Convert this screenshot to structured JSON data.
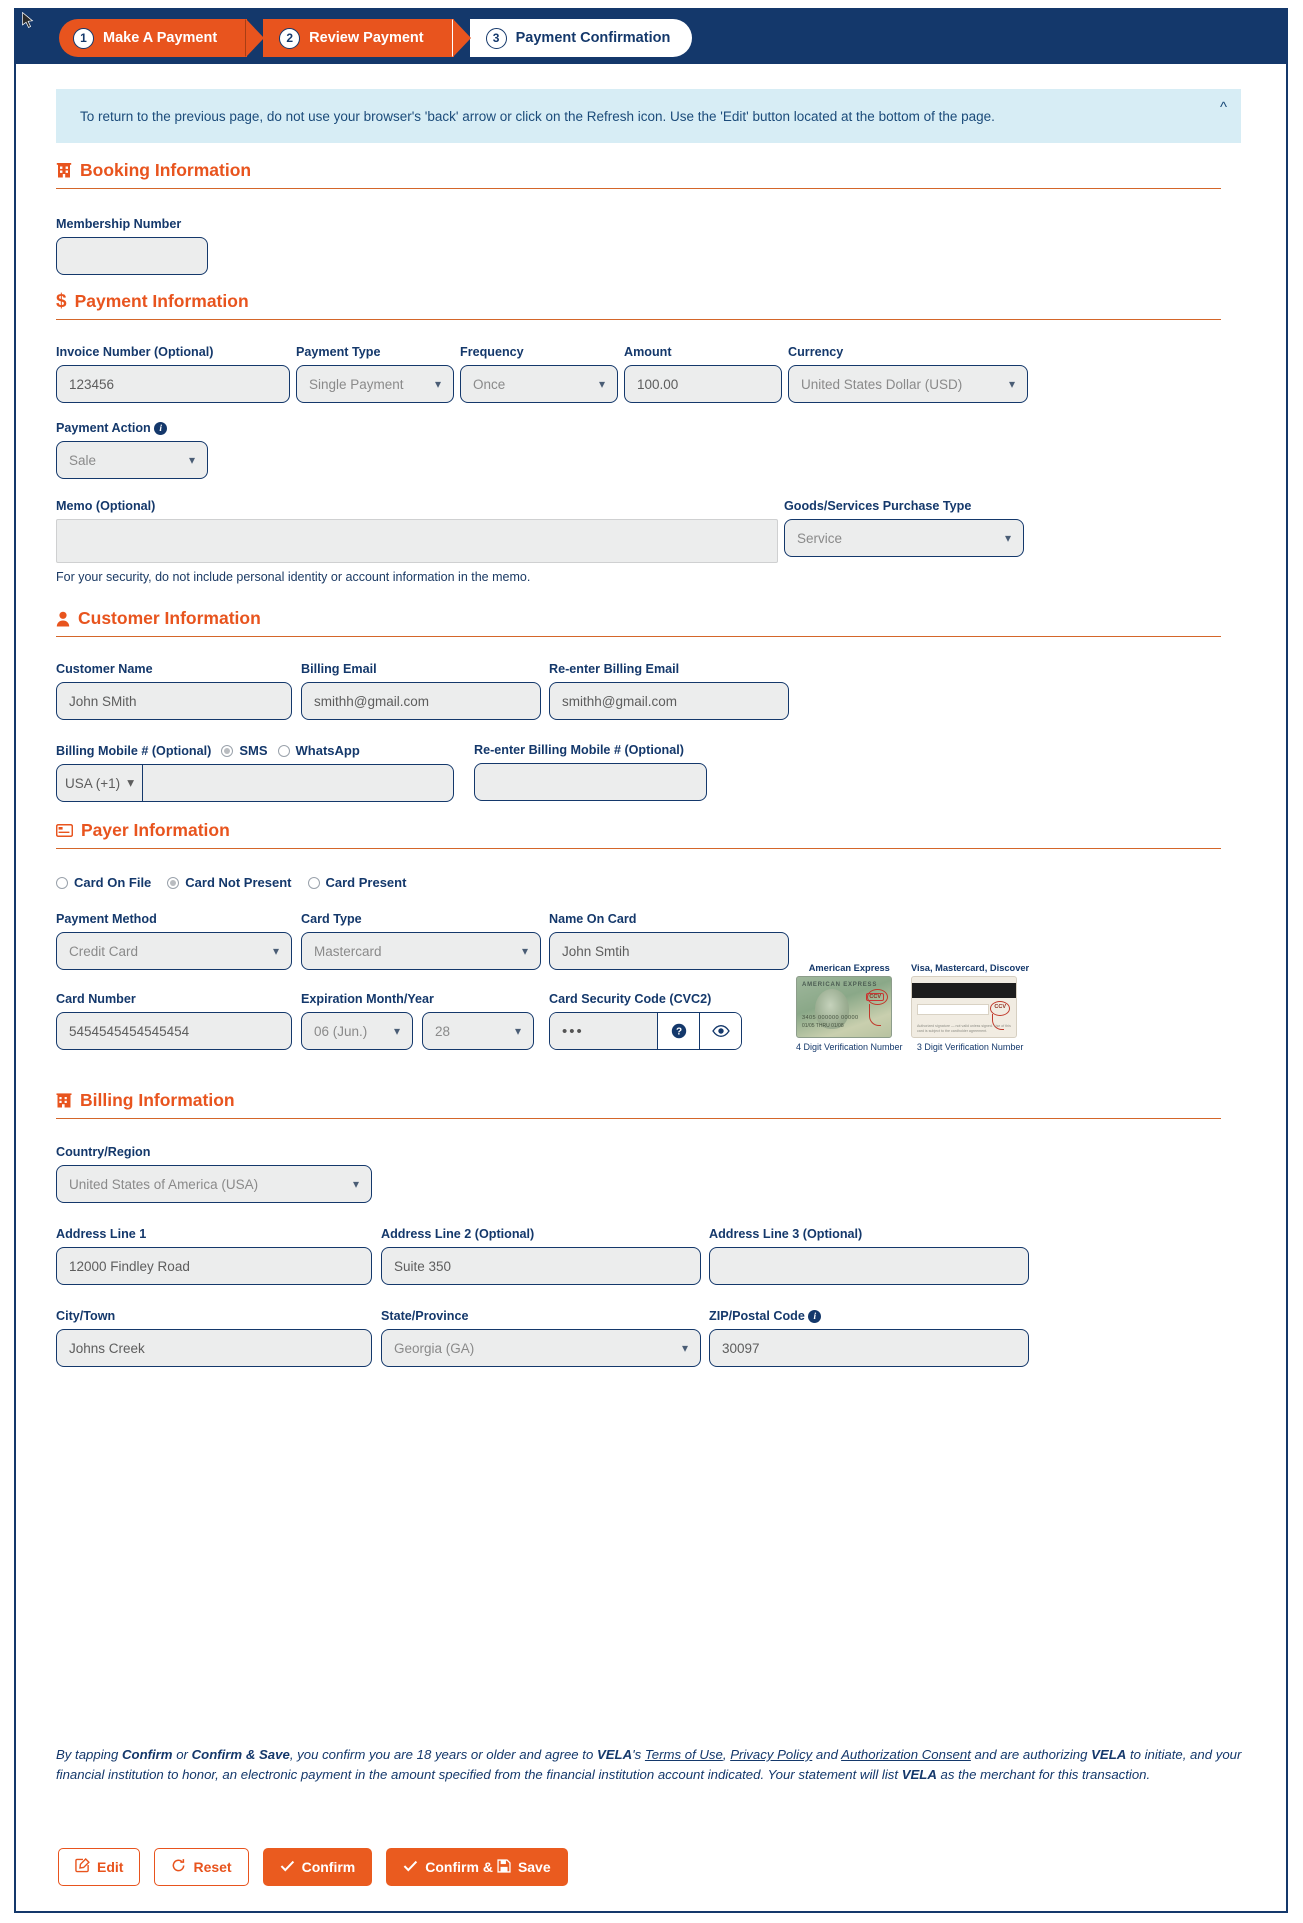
{
  "steps": [
    {
      "num": "1",
      "label": "Make A Payment",
      "state": "done"
    },
    {
      "num": "2",
      "label": "Review Payment",
      "state": "done"
    },
    {
      "num": "3",
      "label": "Payment Confirmation",
      "state": "current"
    }
  ],
  "alert": {
    "text": "To return to the previous page, do not use your browser's 'back' arrow or click on the Refresh icon. Use the 'Edit' button located at the bottom of the page.",
    "collapse_icon": "chevron-up-icon"
  },
  "booking": {
    "heading": "Booking Information",
    "icon": "building-icon",
    "membership_label": "Membership Number",
    "membership_value": ""
  },
  "payment": {
    "heading": "Payment Information",
    "icon": "dollar-icon",
    "invoice_label": "Invoice Number (Optional)",
    "invoice_value": "123456",
    "type_label": "Payment Type",
    "type_value": "Single Payment",
    "frequency_label": "Frequency",
    "frequency_value": "Once",
    "amount_label": "Amount",
    "amount_value": "100.00",
    "currency_label": "Currency",
    "currency_value": "United States Dollar (USD)",
    "action_label": "Payment Action",
    "action_value": "Sale",
    "memo_label": "Memo (Optional)",
    "memo_value": "",
    "memo_hint": "For your security, do not include personal identity or account information in the memo.",
    "goods_label": "Goods/Services Purchase Type",
    "goods_value": "Service"
  },
  "customer": {
    "heading": "Customer Information",
    "icon": "person-icon",
    "name_label": "Customer Name",
    "name_value": "John SMith",
    "email_label": "Billing Email",
    "email_value": "smithh@gmail.com",
    "email2_label": "Re-enter Billing Email",
    "email2_value": "smithh@gmail.com",
    "mobile_label": "Billing Mobile # (Optional)",
    "sms_label": "SMS",
    "whatsapp_label": "WhatsApp",
    "country_code": "USA (+1)",
    "mobile_value": "",
    "mobile2_label": "Re-enter Billing Mobile # (Optional)",
    "mobile2_value": ""
  },
  "payer": {
    "heading": "Payer Information",
    "icon": "credit-card-icon",
    "options": [
      {
        "label": "Card On File",
        "selected": false
      },
      {
        "label": "Card Not Present",
        "selected": true
      },
      {
        "label": "Card Present",
        "selected": false
      }
    ],
    "method_label": "Payment Method",
    "method_value": "Credit Card",
    "cardtype_label": "Card Type",
    "cardtype_value": "Mastercard",
    "nameoncard_label": "Name On Card",
    "nameoncard_value": "John Smtih",
    "cardnum_label": "Card Number",
    "cardnum_value": "5454545454545454",
    "exp_label": "Expiration Month/Year",
    "exp_month": "06 (Jun.)",
    "exp_year": "28",
    "cvc_label": "Card Security Code (CVC2)",
    "cvc_value": "•••",
    "cvc_help_icon": "question-circle-icon",
    "cvc_eye_icon": "eye-icon",
    "amex_caption_top": "American Express",
    "amex_caption_bottom": "4 Digit Verification Number",
    "amex_card_brand": "AMERICAN EXPRESS",
    "amex_card_number": "3405 000000 00000",
    "amex_card_exp": "01/05 THRU 01/08",
    "amex_cvc_tag": "CCV",
    "vm_caption_top": "Visa, Mastercard, Discover",
    "vm_caption_bottom": "3 Digit Verification Number",
    "vm_cvc_tag": "CCV",
    "vm_fine_print": "Authorized signature — not valid unless signed. Use of this card is subject to the cardholder agreement."
  },
  "billing": {
    "heading": "Billing Information",
    "icon": "bank-icon",
    "country_label": "Country/Region",
    "country_value": "United States of America (USA)",
    "addr1_label": "Address Line 1",
    "addr1_value": "12000 Findley Road",
    "addr2_label": "Address Line 2 (Optional)",
    "addr2_value": "Suite 350",
    "addr3_label": "Address Line 3 (Optional)",
    "addr3_value": "",
    "city_label": "City/Town",
    "city_value": "Johns Creek",
    "state_label": "State/Province",
    "state_value": "Georgia (GA)",
    "zip_label": "ZIP/Postal Code",
    "zip_value": "30097"
  },
  "legal": {
    "p1": "By tapping ",
    "confirm": "Confirm",
    "or": " or ",
    "confirm_save": "Confirm & Save",
    "p2": ", you confirm you are 18 years or older and agree to ",
    "brand1": "VELA",
    "p3": "'s ",
    "terms": "Terms of Use",
    "comma": ", ",
    "privacy": "Privacy Policy",
    "and": " and ",
    "authorization": "Authorization Consent",
    "p4": " and are authorizing ",
    "brand2": "VELA",
    "p5": " to initiate, and your financial institution to honor, an electronic payment in the amount specified from the financial institution account indicated. Your statement will list ",
    "brand3": "VELA",
    "p6": " as the merchant for this transaction."
  },
  "buttons": {
    "edit": "Edit",
    "edit_icon": "edit-square-icon",
    "reset": "Reset",
    "reset_icon": "refresh-icon",
    "confirm": "Confirm",
    "confirm_icon": "check-icon",
    "confirm_save": "Confirm & ",
    "confirm_save_2": "Save",
    "confirm_save_icon": "check-icon",
    "save_icon": "floppy-disk-icon"
  },
  "colors": {
    "navy": "#14386b",
    "orange": "#e8541e",
    "alert_bg": "#d7edf5",
    "field_bg": "#eceded"
  }
}
